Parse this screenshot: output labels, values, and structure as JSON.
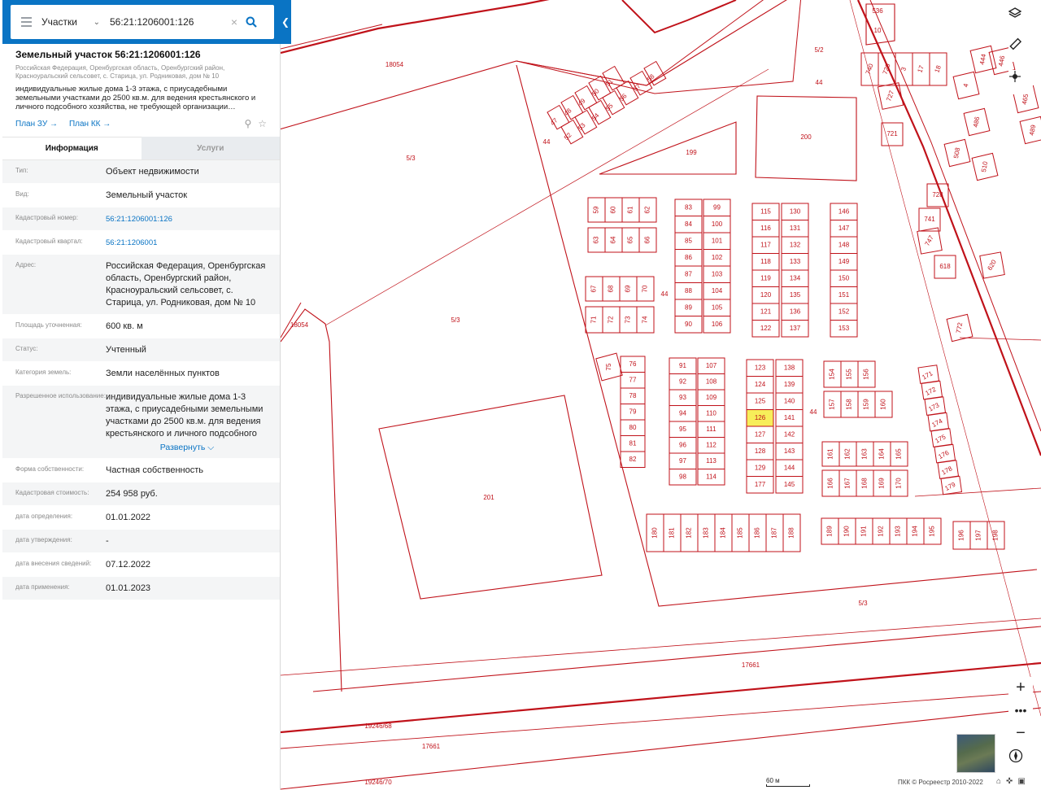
{
  "search": {
    "type_label": "Участки",
    "query": "56:21:1206001:126"
  },
  "object": {
    "title": "Земельный участок 56:21:1206001:126",
    "address": "Российская Федерация, Оренбургская область, Оренбургский район, Красноуральский сельсовет, с. Старица, ул. Родниковая, дом № 10",
    "usage": "индивидуальные жилые дома 1-3 этажа, с приусадебными земельными участками до 2500 кв.м. для ведения крестьянского и личного подсобного хозяйства, не требующей организации…",
    "links": [
      "План ЗУ →",
      "План КК →"
    ]
  },
  "tabs": [
    "Информация",
    "Услуги"
  ],
  "properties": [
    {
      "label": "Тип:",
      "value": "Объект недвижимости"
    },
    {
      "label": "Вид:",
      "value": "Земельный участок"
    },
    {
      "label": "Кадастровый номер:",
      "value": "56:21:1206001:126",
      "link": true
    },
    {
      "label": "Кадастровый квартал:",
      "value": "56:21:1206001",
      "link": true
    },
    {
      "label": "Адрес:",
      "value": "Российская Федерация, Оренбургская область, Оренбургский район, Красноуральский сельсовет, с. Старица, ул. Родниковая, дом № 10"
    },
    {
      "label": "Площадь уточненная:",
      "value": "600 кв. м"
    },
    {
      "label": "Статус:",
      "value": "Учтенный"
    },
    {
      "label": "Категория земель:",
      "value": "Земли населённых пунктов"
    },
    {
      "label": "Разрешенное использование:",
      "value": "индивидуальные жилые дома 1-3 этажа, с приусадебными земельными участками до 2500 кв.м. для ведения крестьянского и личного подсобного хозяйства, не требующей организации",
      "expand": "Развернуть"
    },
    {
      "label": "Форма собственности:",
      "value": "Частная собственность"
    },
    {
      "label": "Кадастровая стоимость:",
      "value": "254 958 руб."
    },
    {
      "label": "дата определения:",
      "value": "01.01.2022"
    },
    {
      "label": "дата утверждения:",
      "value": "-"
    },
    {
      "label": "дата внесения сведений:",
      "value": "07.12.2022"
    },
    {
      "label": "дата применения:",
      "value": "01.01.2023"
    }
  ],
  "map": {
    "scale_label": "60 м",
    "copyright": "ПКК © Росреестр 2010-2022",
    "line_color": "#c0121a",
    "highlight_color": "#f7ee5a",
    "selected_parcel": "126",
    "area_labels": [
      "18054",
      "18054",
      "5/3",
      "5/3",
      "5/3",
      "5/2",
      "44",
      "44",
      "44",
      "44",
      "199",
      "200",
      "201",
      "536",
      "10",
      "17661",
      "17661",
      "19246/68",
      "19246/70"
    ],
    "parcel_groups": [
      [
        "59",
        "60",
        "61",
        "62"
      ],
      [
        "63",
        "64",
        "65",
        "66"
      ],
      [
        "67",
        "68",
        "69",
        "70"
      ],
      [
        "71",
        "72",
        "73",
        "74"
      ],
      [
        "83",
        "84",
        "85",
        "86",
        "87",
        "88",
        "89",
        "90"
      ],
      [
        "99",
        "100",
        "101",
        "102",
        "103",
        "104",
        "105",
        "106"
      ],
      [
        "115",
        "116",
        "117",
        "118",
        "119",
        "120",
        "121",
        "122"
      ],
      [
        "130",
        "131",
        "132",
        "133",
        "134",
        "135",
        "136",
        "137"
      ],
      [
        "146",
        "147",
        "148",
        "149",
        "150",
        "151",
        "152",
        "153"
      ],
      [
        "76",
        "77",
        "78",
        "79",
        "80",
        "81",
        "82"
      ],
      [
        "91",
        "92",
        "93",
        "94",
        "95",
        "96",
        "97",
        "98"
      ],
      [
        "107",
        "108",
        "109",
        "110",
        "111",
        "112",
        "113",
        "114"
      ],
      [
        "123",
        "124",
        "125",
        "126",
        "127",
        "128",
        "129",
        "177"
      ],
      [
        "138",
        "139",
        "140",
        "141",
        "142",
        "143",
        "144",
        "145"
      ],
      [
        "154",
        "155",
        "156"
      ],
      [
        "157",
        "158",
        "159",
        "160"
      ],
      [
        "161",
        "162",
        "163",
        "164",
        "165"
      ],
      [
        "166",
        "167",
        "168",
        "169",
        "170"
      ],
      [
        "180",
        "181",
        "182",
        "183",
        "184",
        "185",
        "186",
        "187",
        "188"
      ],
      [
        "189",
        "190",
        "191",
        "192",
        "193",
        "194",
        "195"
      ],
      [
        "196",
        "197",
        "198"
      ],
      [
        "171",
        "172",
        "173",
        "174",
        "175",
        "176",
        "178",
        "179"
      ],
      [
        "47",
        "48",
        "49",
        "50",
        "51"
      ],
      [
        "52",
        "53",
        "54",
        "55",
        "56",
        "57",
        "58"
      ],
      [
        "740",
        "720",
        "3",
        "17",
        "18"
      ],
      [
        "727",
        "721",
        "728",
        "741",
        "747",
        "508",
        "510",
        "486",
        "4",
        "465",
        "444",
        "446",
        "489",
        "618",
        "620",
        "772",
        "75"
      ]
    ]
  }
}
